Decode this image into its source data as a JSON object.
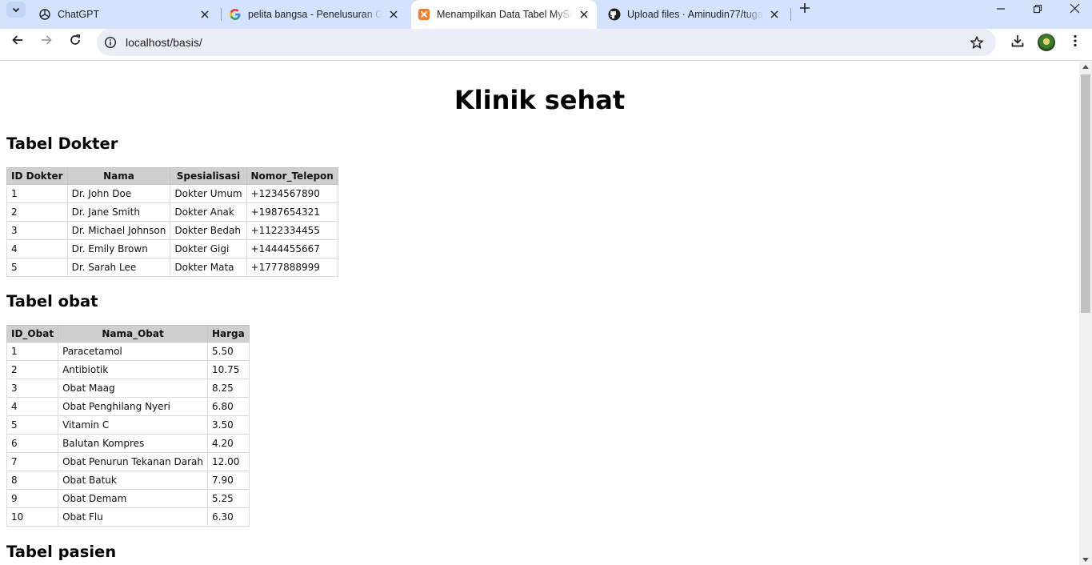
{
  "browser": {
    "tabs": [
      {
        "title": "ChatGPT",
        "icon": "chatgpt-icon",
        "active": false
      },
      {
        "title": "pelita bangsa - Penelusuran Google",
        "icon": "google-icon",
        "active": false
      },
      {
        "title": "Menampilkan Data Tabel MySQL",
        "icon": "xampp-icon",
        "active": true
      },
      {
        "title": "Upload files · Aminudin77/tugas",
        "icon": "github-icon",
        "active": false
      }
    ],
    "url": "localhost/basis/"
  },
  "page": {
    "title": "Klinik sehat",
    "sections": {
      "dokter": {
        "heading": "Tabel Dokter",
        "columns": [
          "ID Dokter",
          "Nama",
          "Spesialisasi",
          "Nomor_Telepon"
        ],
        "rows": [
          [
            "1",
            "Dr. John Doe",
            "Dokter Umum",
            "+1234567890"
          ],
          [
            "2",
            "Dr. Jane Smith",
            "Dokter Anak",
            "+1987654321"
          ],
          [
            "3",
            "Dr. Michael Johnson",
            "Dokter Bedah",
            "+1122334455"
          ],
          [
            "4",
            "Dr. Emily Brown",
            "Dokter Gigi",
            "+1444455667"
          ],
          [
            "5",
            "Dr. Sarah Lee",
            "Dokter Mata",
            "+1777888999"
          ]
        ]
      },
      "obat": {
        "heading": "Tabel obat",
        "columns": [
          "ID_Obat",
          "Nama_Obat",
          "Harga"
        ],
        "rows": [
          [
            "1",
            "Paracetamol",
            "5.50"
          ],
          [
            "2",
            "Antibiotik",
            "10.75"
          ],
          [
            "3",
            "Obat Maag",
            "8.25"
          ],
          [
            "4",
            "Obat Penghilang Nyeri",
            "6.80"
          ],
          [
            "5",
            "Vitamin C",
            "3.50"
          ],
          [
            "6",
            "Balutan Kompres",
            "4.20"
          ],
          [
            "7",
            "Obat Penurun Tekanan Darah",
            "12.00"
          ],
          [
            "8",
            "Obat Batuk",
            "7.90"
          ],
          [
            "9",
            "Obat Demam",
            "5.25"
          ],
          [
            "10",
            "Obat Flu",
            "6.30"
          ]
        ]
      },
      "pasien": {
        "heading": "Tabel pasien"
      }
    }
  }
}
